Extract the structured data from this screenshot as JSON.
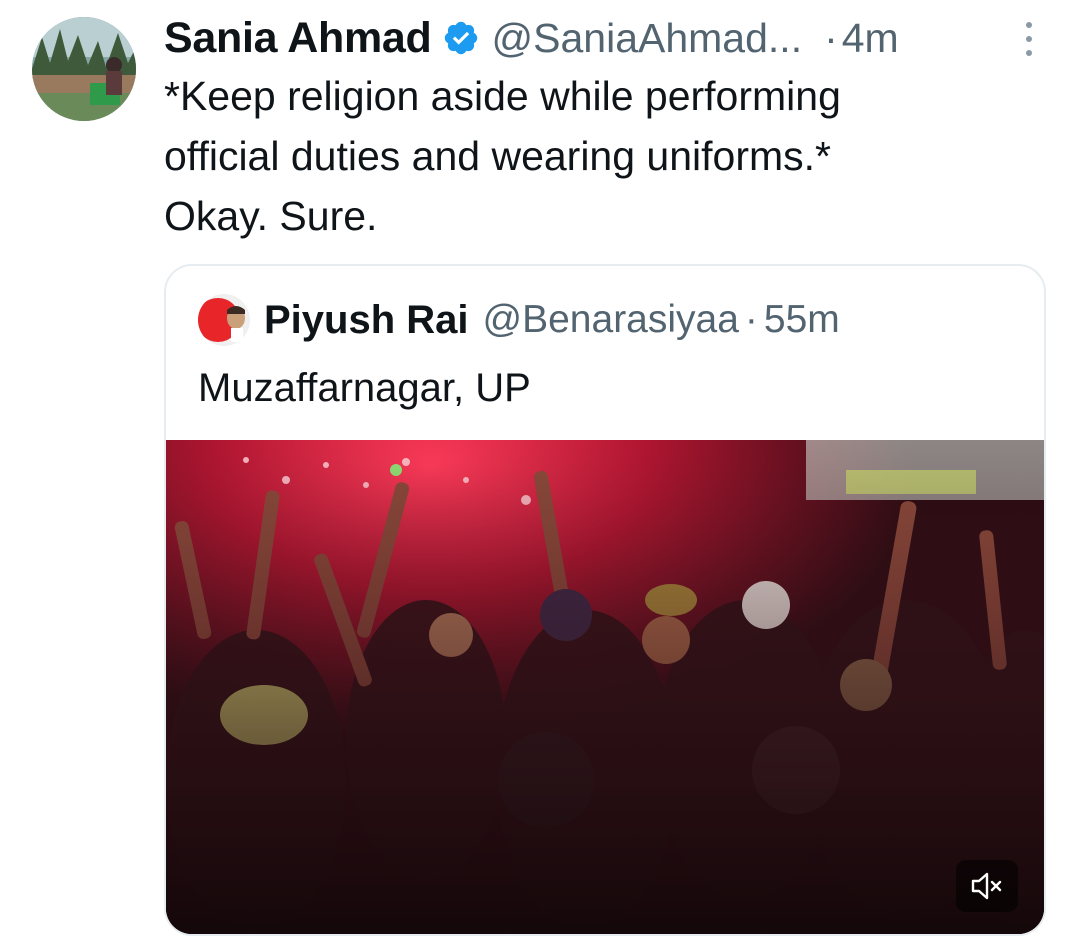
{
  "tweet": {
    "author_name": "Sania Ahmad",
    "author_handle": "@SaniaAhmad...",
    "separator": "·",
    "time": "4m",
    "text": "*Keep religion aside while performing\nofficial duties and wearing uniforms.*\nOkay. Sure.",
    "icons": {
      "verified": "verified-badge-icon",
      "more": "more-options-icon"
    },
    "colors": {
      "verified": "#1d9bf0",
      "secondary_text": "#536471"
    }
  },
  "quote": {
    "author_name": "Piyush Rai",
    "author_handle": "@Benarasiyaa",
    "separator": "·",
    "time": "55m",
    "text": "Muzaffarnagar, UP",
    "media": {
      "type": "video",
      "mute_icon": "volume-muted-icon"
    }
  }
}
